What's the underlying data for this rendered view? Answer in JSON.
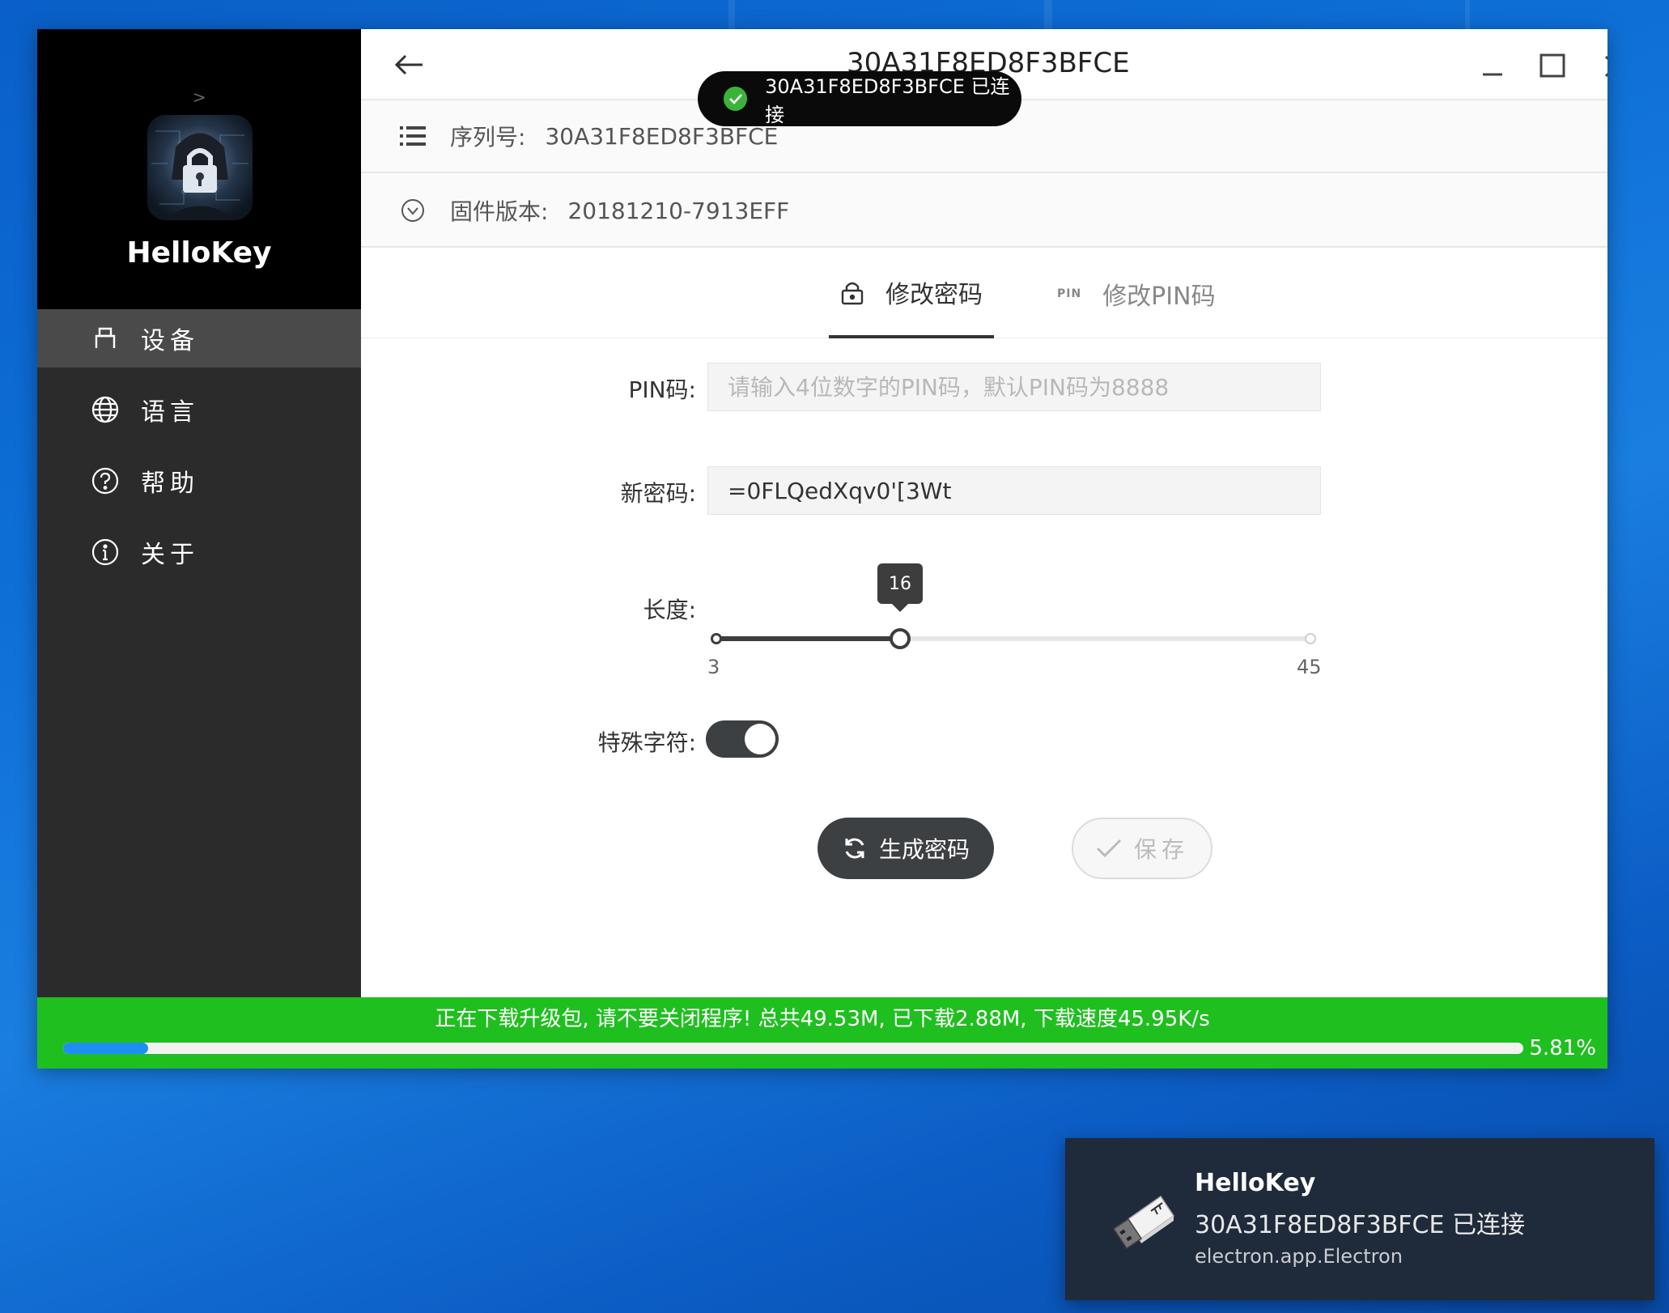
{
  "sidebar": {
    "collapse_glyph": ">",
    "app_name": "HelloKey",
    "items": [
      {
        "label": "设备",
        "icon": "device-icon",
        "active": true
      },
      {
        "label": "语言",
        "icon": "globe-icon",
        "active": false
      },
      {
        "label": "帮助",
        "icon": "help-circle-icon",
        "active": false
      },
      {
        "label": "关于",
        "icon": "info-circle-icon",
        "active": false
      }
    ]
  },
  "titlebar": {
    "title": "30A31F8ED8F3BFCE"
  },
  "toast": {
    "message": "30A31F8ED8F3BFCE 已连接"
  },
  "device_info": {
    "serial_label": "序列号:",
    "serial_value": "30A31F8ED8F3BFCE",
    "firmware_label": "固件版本:",
    "firmware_value": "20181210-7913EFF"
  },
  "tabs": [
    {
      "label": "修改密码",
      "icon": "lock-icon",
      "active": true
    },
    {
      "label": "修改PIN码",
      "icon": "pin-icon",
      "icon_text": "PIN",
      "active": false
    }
  ],
  "form": {
    "pin_label": "PIN码:",
    "pin_placeholder": "请输入4位数字的PIN码，默认PIN码为8888",
    "pin_value": "",
    "password_label": "新密码:",
    "password_value": "=0FLQedXqv0'[3Wt",
    "length_label": "长度:",
    "length_min": 3,
    "length_max": 45,
    "length_value": 16,
    "length_min_text": "3",
    "length_max_text": "45",
    "length_value_text": "16",
    "special_chars_label": "特殊字符:",
    "special_chars_enabled": true
  },
  "buttons": {
    "generate_label": "生成密码",
    "save_label": "保存"
  },
  "update": {
    "message": "正在下载升级包, 请不要关闭程序! 总共49.53M, 已下载2.88M, 下载速度45.95K/s",
    "percent_text": "5.81%",
    "progress": 0.0581
  },
  "notification": {
    "title": "HelloKey",
    "body": "30A31F8ED8F3BFCE 已连接",
    "source": "electron.app.Electron"
  },
  "colors": {
    "sidebar_bg": "#2b2b2b",
    "accent_dark": "#3d4043",
    "update_green": "#1fbf1f",
    "progress_blue": "#1f8ef2",
    "toast_check": "#3bb33b"
  }
}
